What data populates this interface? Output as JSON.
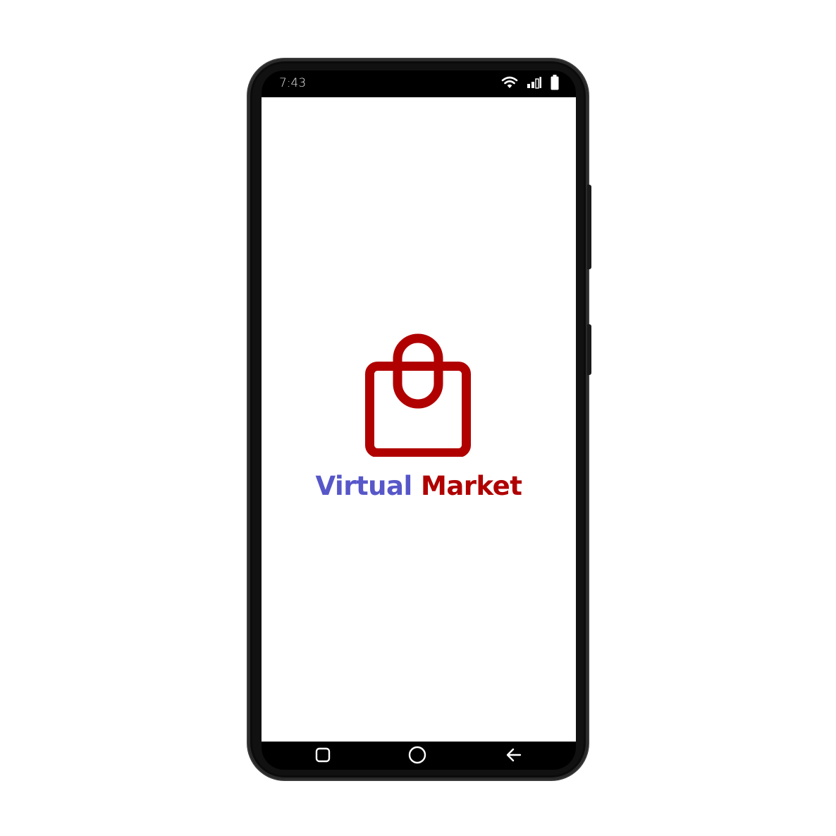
{
  "status_bar": {
    "time": "7:43",
    "icons": [
      "wifi-icon",
      "signal-icon",
      "battery-icon"
    ]
  },
  "app": {
    "title_part1": "Virtual",
    "title_part2": "Market",
    "logo_icon": "shopping-bag-icon"
  },
  "nav_bar": {
    "buttons": [
      "recents-icon",
      "home-icon",
      "back-icon"
    ]
  },
  "colors": {
    "brand_red": "#b00000",
    "brand_blue": "#5757c9",
    "bezel": "#111111"
  }
}
